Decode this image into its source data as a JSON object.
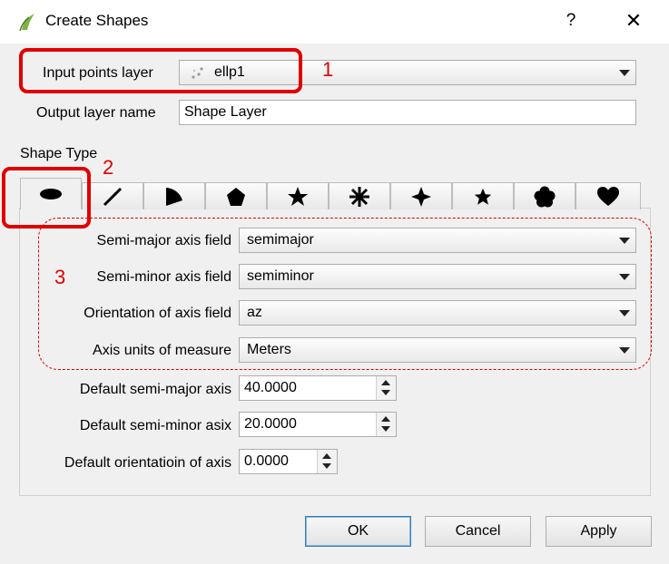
{
  "window": {
    "title": "Create Shapes",
    "help_label": "?",
    "close_label": "✕"
  },
  "input_layer": {
    "label": "Input points layer",
    "value": "ellp1"
  },
  "output_layer": {
    "label": "Output layer name",
    "value": "Shape Layer"
  },
  "shape_type": {
    "label": "Shape Type",
    "tabs": [
      {
        "name": "ellipse-icon",
        "active": true
      },
      {
        "name": "line-icon"
      },
      {
        "name": "pie-wedge-icon"
      },
      {
        "name": "pentagon-icon"
      },
      {
        "name": "star-icon"
      },
      {
        "name": "asterisk-icon"
      },
      {
        "name": "four-point-star-icon"
      },
      {
        "name": "small-star-icon"
      },
      {
        "name": "flower-icon"
      },
      {
        "name": "heart-icon"
      }
    ]
  },
  "fields": {
    "semi_major": {
      "label": "Semi-major axis field",
      "value": "semimajor"
    },
    "semi_minor": {
      "label": "Semi-minor axis field",
      "value": "semiminor"
    },
    "orientation": {
      "label": "Orientation of axis field",
      "value": "az"
    },
    "units": {
      "label": "Axis units of measure",
      "value": "Meters"
    }
  },
  "defaults": {
    "semi_major": {
      "label": "Default semi-major axis",
      "value": "40.0000"
    },
    "semi_minor": {
      "label": "Default semi-minor asix",
      "value": "20.0000"
    },
    "orientation": {
      "label": "Default orientatioin of axis",
      "value": "0.0000"
    }
  },
  "buttons": {
    "ok": "OK",
    "cancel": "Cancel",
    "apply": "Apply"
  },
  "annotations": {
    "n1": "1",
    "n2": "2",
    "n3": "3"
  },
  "colors": {
    "annotation": "#e00000",
    "accent": "#3c7fb1",
    "app_icon": "#7cb342"
  }
}
